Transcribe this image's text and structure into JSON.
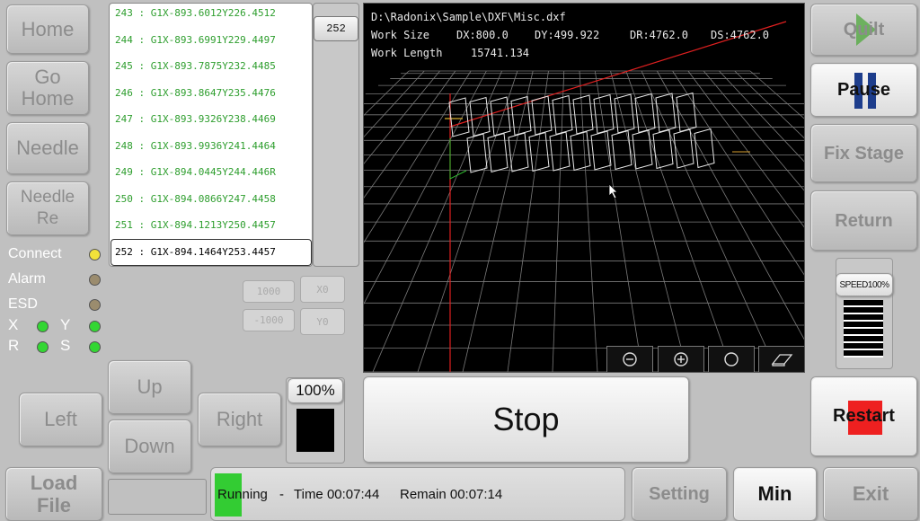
{
  "left_buttons": {
    "home": "Home",
    "go_home": "Go\nHome",
    "needle": "Needle",
    "needle_re": "Needle\nRe"
  },
  "status_labels": {
    "connect": "Connect",
    "alarm": "Alarm",
    "esd": "ESD",
    "x": "X",
    "y": "Y",
    "r": "R",
    "s": "S"
  },
  "colors": {
    "led_connect": "#f2e23a",
    "led_off": "#9b8c6e",
    "led_green": "#33d633",
    "running": "#33cc33",
    "restart_red": "#ee2020"
  },
  "code_lines": [
    {
      "num": "243",
      "text": "G1X-893.6012Y226.4512"
    },
    {
      "num": "244",
      "text": "G1X-893.6991Y229.4497"
    },
    {
      "num": "245",
      "text": "G1X-893.7875Y232.4485"
    },
    {
      "num": "246",
      "text": "G1X-893.8647Y235.4476"
    },
    {
      "num": "247",
      "text": "G1X-893.9326Y238.4469"
    },
    {
      "num": "248",
      "text": "G1X-893.9936Y241.4464"
    },
    {
      "num": "249",
      "text": "G1X-894.0445Y244.446R"
    },
    {
      "num": "250",
      "text": "G1X-894.0866Y247.4458"
    },
    {
      "num": "251",
      "text": "G1X-894.1213Y250.4457"
    },
    {
      "num": "252",
      "text": "G1X-894.1464Y253.4457"
    }
  ],
  "scroll_value": "252",
  "offsets": {
    "x_value": "1000",
    "x_button": "X0",
    "y_value": "-1000",
    "y_button": "Y0"
  },
  "jog": {
    "up": "Up",
    "left": "Left",
    "right": "Right",
    "down": "Down"
  },
  "zoom_percent": "100%",
  "view": {
    "file_path": "D:\\Radonix\\Sample\\DXF\\Misc.dxf",
    "work_size_label": "Work Size",
    "dx": "DX:800.0",
    "dy": "DY:499.922",
    "dr": "DR:4762.0",
    "ds": "DS:4762.0",
    "work_length_label": "Work Length",
    "work_length": "15741.134"
  },
  "view_tools": [
    "zoom-out-icon",
    "zoom-in-icon",
    "circle-icon",
    "eraser-icon"
  ],
  "stop_label": "Stop",
  "right_buttons": {
    "quilt": "Quilt",
    "pause": "Pause",
    "fix_stage": "Fix Stage",
    "return": "Return",
    "restart": "Restart"
  },
  "speed": {
    "label": "SPEED100%",
    "value": 1.0
  },
  "bottom": {
    "load_file": "Load\nFile",
    "status": "Running",
    "time_label": "Time 00:07:44",
    "remain_label": "Remain 00:07:14",
    "setting": "Setting",
    "min": "Min",
    "exit": "Exit"
  }
}
